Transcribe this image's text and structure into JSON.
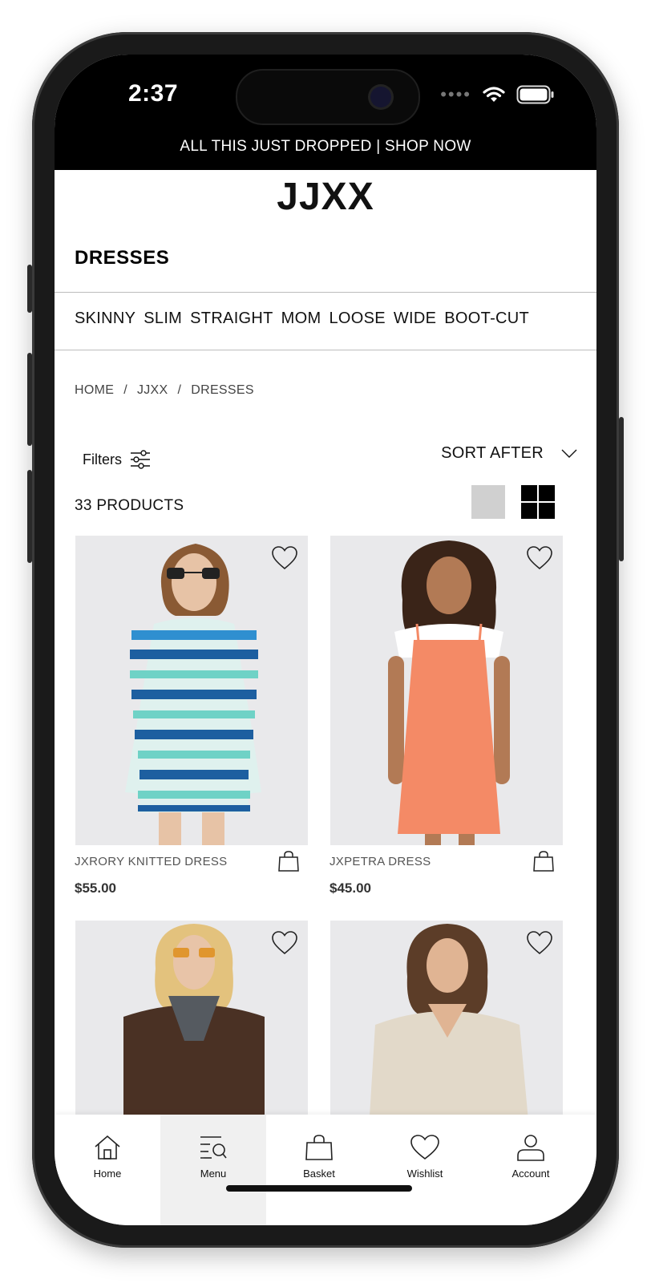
{
  "status_bar": {
    "time": "2:37"
  },
  "promo_banner": "ALL THIS JUST DROPPED | SHOP NOW",
  "brand": "JJXX",
  "page_title": "DRESSES",
  "fit_filters": [
    "SKINNY",
    "SLIM",
    "STRAIGHT",
    "MOM",
    "LOOSE",
    "WIDE",
    "BOOT-CUT"
  ],
  "breadcrumb": [
    "HOME",
    "/",
    "JJXX",
    "/",
    "DRESSES"
  ],
  "toolbar": {
    "filters_label": "Filters",
    "sort_label": "SORT AFTER"
  },
  "product_count": "33 PRODUCTS",
  "products": [
    {
      "name": "JXRORY KNITTED DRESS",
      "price": "$55.00"
    },
    {
      "name": "JXPETRA DRESS",
      "price": "$45.00"
    },
    {
      "name": "",
      "price": ""
    },
    {
      "name": "",
      "price": ""
    }
  ],
  "tabbar": [
    {
      "label": "Home",
      "icon": "home-icon"
    },
    {
      "label": "Menu",
      "icon": "menu-search-icon",
      "active": true
    },
    {
      "label": "Basket",
      "icon": "basket-icon"
    },
    {
      "label": "Wishlist",
      "icon": "heart-icon"
    },
    {
      "label": "Account",
      "icon": "account-icon"
    }
  ]
}
